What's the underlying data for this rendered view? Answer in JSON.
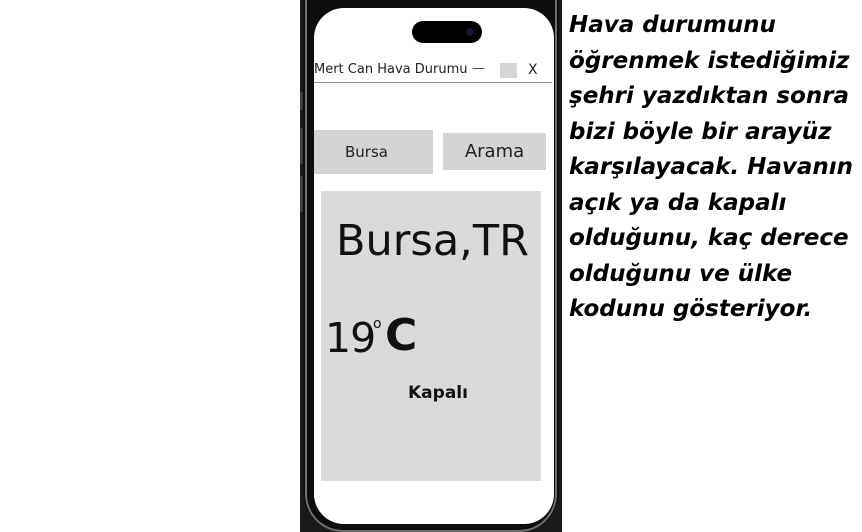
{
  "window": {
    "title": "Mert Can Hava Durumu",
    "minimize_label": "—",
    "close_label": "X"
  },
  "search": {
    "city_value": "Bursa",
    "button_label": "Arama"
  },
  "weather": {
    "city": "Bursa,TR",
    "temperature": "19",
    "degree_symbol": "o",
    "unit": "C",
    "condition": "Kapalı"
  },
  "caption": {
    "text": "Hava durumunu öğrenmek istediğimiz şehri yazdıktan sonra bizi böyle bir arayüz karşılayacak. Havanın açık ya da kapalı olduğunu, kaç derece olduğunu ve ülke kodunu gösteriyor."
  },
  "colors": {
    "panel": "#dadada",
    "input": "#d4d4d4",
    "frame": "#0d0d0d"
  }
}
